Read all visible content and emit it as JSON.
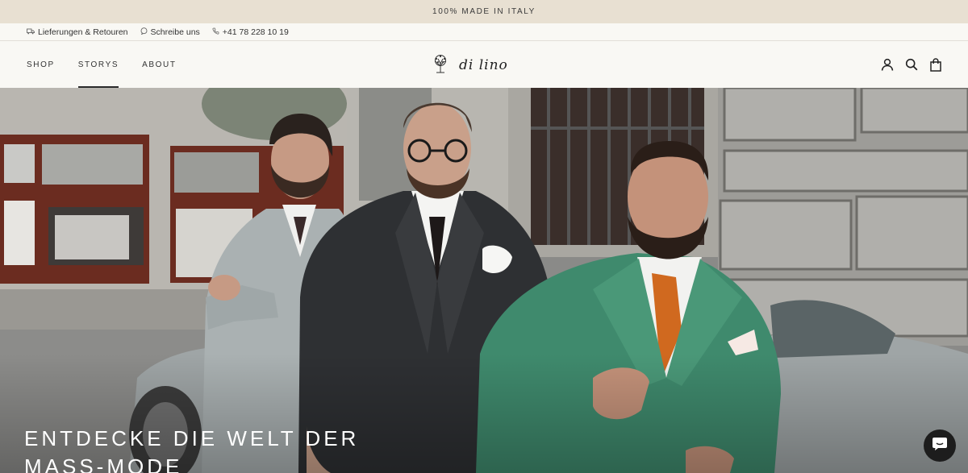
{
  "announcement": {
    "text": "100% MADE IN ITALY"
  },
  "infobar": {
    "items": [
      {
        "icon": "truck-icon",
        "label": "Lieferungen & Retouren"
      },
      {
        "icon": "chat-icon",
        "label": "Schreibe uns"
      },
      {
        "icon": "phone-icon",
        "label": "+41 78 228 10 19"
      }
    ]
  },
  "nav": {
    "items": [
      {
        "label": "SHOP",
        "active": false
      },
      {
        "label": "STORYS",
        "active": true
      },
      {
        "label": "ABOUT",
        "active": false
      }
    ]
  },
  "logo": {
    "text": "di lino",
    "icon": "tree-logo-icon"
  },
  "header_icons": [
    "account-icon",
    "search-icon",
    "cart-icon"
  ],
  "hero": {
    "title_line1": "ENTDECKE DIE WELT DER",
    "title_line2": "MASS-MODE"
  },
  "chat": {
    "icon": "chat-bubble-icon"
  },
  "colors": {
    "announcement_bg": "#e8e0d2",
    "header_bg": "#f9f8f4",
    "accent_green_suit": "#3f8a6d",
    "accent_tie": "#d0691f"
  }
}
